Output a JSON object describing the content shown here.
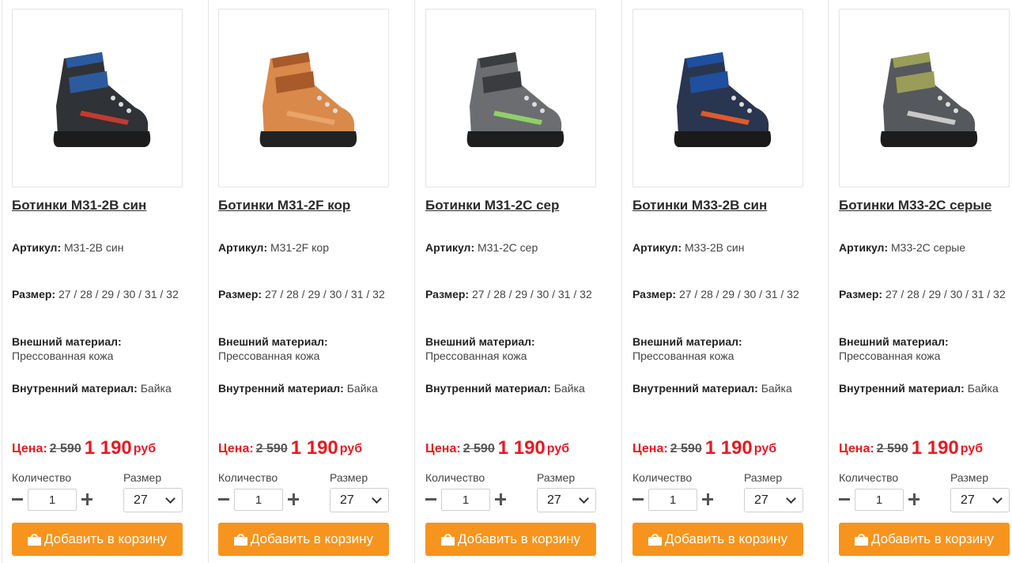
{
  "labels": {
    "article": "Артикул:",
    "size": "Размер:",
    "outer_material": "Внешний материал:",
    "inner_material": "Внутренний материал:",
    "price": "Цена:",
    "currency": "руб",
    "quantity": "Количество",
    "size_select": "Размер",
    "add_to_cart": "Добавить в корзину"
  },
  "products": [
    {
      "title": "Ботинки M31-2B син",
      "article": "M31-2B син",
      "sizes": "27 / 28 / 29 / 30 / 31 / 32",
      "outer_material": "Прессованная кожа",
      "inner_material": "Байка",
      "old_price": "2 590",
      "price": "1 190",
      "quantity": "1",
      "selected_size": "27",
      "colors": {
        "upper": "#2f3236",
        "accent": "#2c5a9e",
        "sole": "#1c1c1c",
        "trim": "#c23b2e"
      }
    },
    {
      "title": "Ботинки M31-2F кор",
      "article": "M31-2F кор",
      "sizes": "27 / 28 / 29 / 30 / 31 / 32",
      "outer_material": "Прессованная кожа",
      "inner_material": "Байка",
      "old_price": "2 590",
      "price": "1 190",
      "quantity": "1",
      "selected_size": "27",
      "colors": {
        "upper": "#d98a4a",
        "accent": "#a85a2a",
        "sole": "#222222",
        "trim": "#e9a46a"
      }
    },
    {
      "title": "Ботинки M31-2C сер",
      "article": "M31-2C сер",
      "sizes": "27 / 28 / 29 / 30 / 31 / 32",
      "outer_material": "Прессованная кожа",
      "inner_material": "Байка",
      "old_price": "2 590",
      "price": "1 190",
      "quantity": "1",
      "selected_size": "27",
      "colors": {
        "upper": "#6b6d70",
        "accent": "#3a3c3f",
        "sole": "#1e1e1e",
        "trim": "#8fd06a"
      }
    },
    {
      "title": "Ботинки M33-2B син",
      "article": "M33-2B син",
      "sizes": "27 / 28 / 29 / 30 / 31 / 32",
      "outer_material": "Прессованная кожа",
      "inner_material": "Байка",
      "old_price": "2 590",
      "price": "1 190",
      "quantity": "1",
      "selected_size": "27",
      "colors": {
        "upper": "#2a3550",
        "accent": "#1f4f9e",
        "sole": "#1a1a1a",
        "trim": "#e05a2a"
      }
    },
    {
      "title": "Ботинки M33-2C серые",
      "article": "M33-2C серые",
      "sizes": "27 / 28 / 29 / 30 / 31 / 32",
      "outer_material": "Прессованная кожа",
      "inner_material": "Байка",
      "old_price": "2 590",
      "price": "1 190",
      "quantity": "1",
      "selected_size": "27",
      "colors": {
        "upper": "#55585c",
        "accent": "#9a9d58",
        "sole": "#1c1c1c",
        "trim": "#c9c9c9"
      }
    }
  ],
  "theme": {
    "button": "#f7941d",
    "price_red": "#e31b23"
  }
}
